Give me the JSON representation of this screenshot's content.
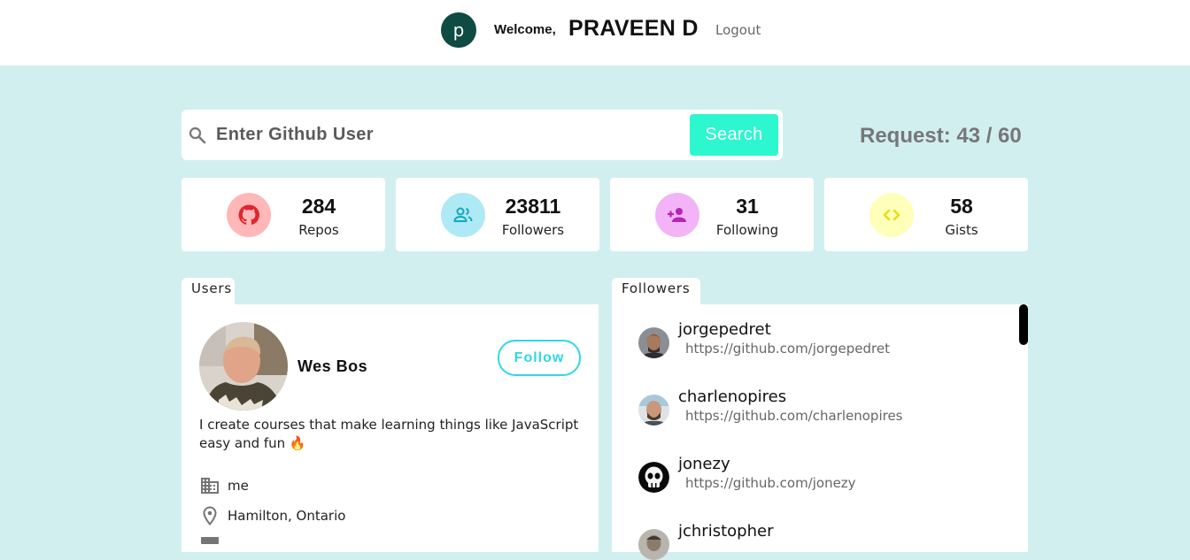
{
  "header": {
    "avatar_letter": "p",
    "welcome_label": "Welcome,",
    "user_name": "PRAVEEN D",
    "logout_label": "Logout"
  },
  "search": {
    "placeholder": "Enter Github User",
    "button_label": "Search",
    "request_text": "Request: 43 / 60"
  },
  "stats": [
    {
      "value": "284",
      "label": "Repos",
      "icon": "github-icon",
      "bg": "#ffb7b7",
      "fg": "#e0262e"
    },
    {
      "value": "23811",
      "label": "Followers",
      "icon": "people-icon",
      "bg": "#aee9f6",
      "fg": "#14a8bf"
    },
    {
      "value": "31",
      "label": "Following",
      "icon": "person-add-icon",
      "bg": "#f2b4f6",
      "fg": "#b425b5"
    },
    {
      "value": "58",
      "label": "Gists",
      "icon": "code-icon",
      "bg": "#feffb8",
      "fg": "#e3de11"
    }
  ],
  "user_panel": {
    "tab_label": "Users",
    "name": "Wes Bos",
    "follow_label": "Follow",
    "bio": "I create courses that make learning things like JavaScript easy and fun 🔥",
    "company": "me",
    "location": "Hamilton, Ontario",
    "accent": "#2ed8e6"
  },
  "followers_panel": {
    "tab_label": "Followers",
    "items": [
      {
        "login": "jorgepedret",
        "url": "https://github.com/jorgepedret"
      },
      {
        "login": "charlenopires",
        "url": "https://github.com/charlenopires"
      },
      {
        "login": "jonezy",
        "url": "https://github.com/jonezy"
      },
      {
        "login": "jchristopher",
        "url": ""
      }
    ]
  }
}
